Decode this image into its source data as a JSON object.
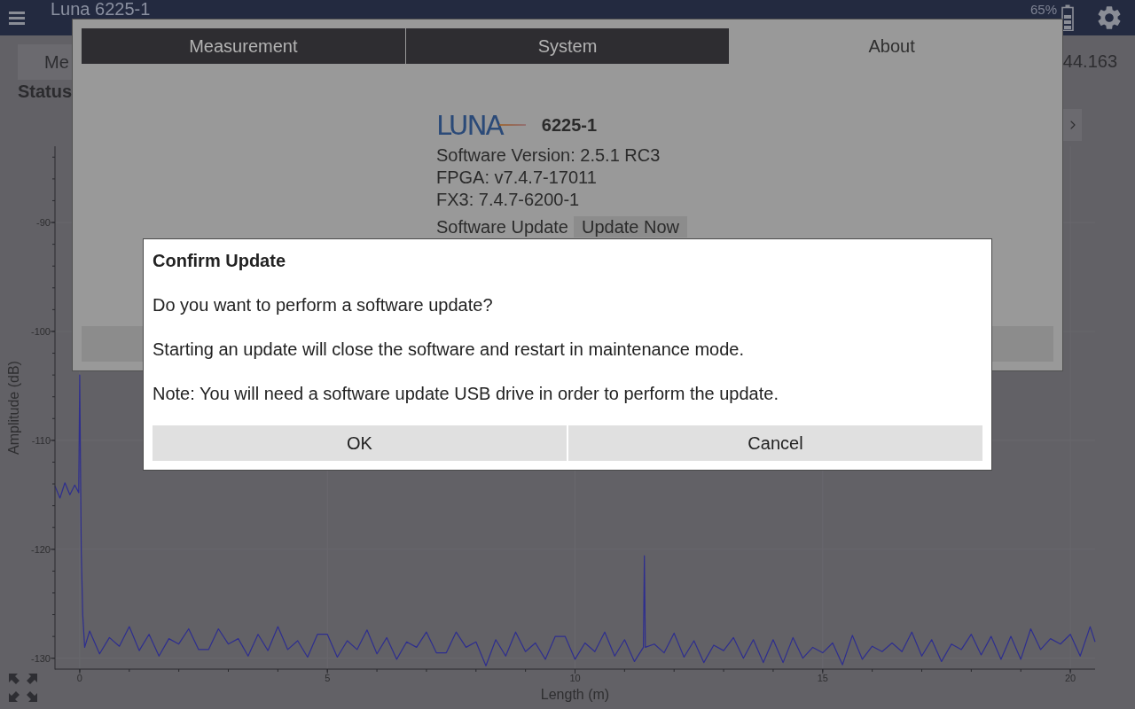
{
  "top_bar": {
    "title": "Luna 6225-1",
    "battery": "65%"
  },
  "main": {
    "mode_button": "Me",
    "status_label": "Status",
    "reading": "44.163"
  },
  "chart": {
    "chart_data": {
      "type": "line",
      "xlabel": "Length (m)",
      "ylabel": "Amplitude (dB)",
      "xlim": [
        -0.5,
        20.5
      ],
      "ylim": [
        -131,
        -83
      ],
      "xticks": [
        0,
        5,
        10,
        15,
        20
      ],
      "yticks": [
        -130,
        -120,
        -110,
        -100,
        -90
      ],
      "x": [
        -0.5,
        -0.4,
        -0.3,
        -0.2,
        -0.1,
        -0.02,
        0,
        0.03,
        0.06,
        0.1,
        0.2,
        0.4,
        0.6,
        0.8,
        1,
        1.2,
        1.4,
        1.6,
        1.8,
        2,
        2.2,
        2.4,
        2.6,
        2.8,
        3,
        3.2,
        3.4,
        3.6,
        3.8,
        4,
        4.2,
        4.4,
        4.6,
        4.8,
        5,
        5.2,
        5.4,
        5.6,
        5.8,
        6,
        6.2,
        6.4,
        6.6,
        6.8,
        7,
        7.2,
        7.4,
        7.6,
        7.8,
        8,
        8.2,
        8.4,
        8.6,
        8.8,
        9,
        9.2,
        9.4,
        9.6,
        9.8,
        10,
        10.2,
        10.4,
        10.6,
        10.8,
        11,
        11.2,
        11.38,
        11.4,
        11.42,
        11.6,
        11.8,
        12,
        12.2,
        12.4,
        12.6,
        12.8,
        13,
        13.2,
        13.4,
        13.6,
        13.8,
        14,
        14.2,
        14.4,
        14.6,
        14.8,
        15,
        15.2,
        15.4,
        15.6,
        15.8,
        16,
        16.2,
        16.4,
        16.6,
        16.8,
        17,
        17.2,
        17.4,
        17.6,
        17.8,
        18,
        18.2,
        18.4,
        18.6,
        18.8,
        19,
        19.2,
        19.4,
        19.6,
        19.8,
        20,
        20.2,
        20.4,
        20.5
      ],
      "series": [
        {
          "color": "#2e2e8f",
          "values": [
            -114.2,
            -115.3,
            -113.9,
            -115.0,
            -114.1,
            -114.8,
            -104,
            -120,
            -126,
            -129,
            -127.5,
            -129.6,
            -128.1,
            -128.9,
            -127.1,
            -129.3,
            -127.8,
            -129.8,
            -128.2,
            -128.7,
            -127.3,
            -129.2,
            -129.2,
            -127.3,
            -128.7,
            -128.2,
            -129.8,
            -127.8,
            -129.3,
            -127.1,
            -129.2,
            -128.4,
            -129.9,
            -127.8,
            -127.8,
            -129.9,
            -128.4,
            -129.2,
            -127.4,
            -129.6,
            -128.1,
            -130.1,
            -128.5,
            -129.0,
            -127.6,
            -129.5,
            -129.5,
            -127.6,
            -129.0,
            -128.5,
            -130.7,
            -128.3,
            -129.8,
            -127.6,
            -129.4,
            -128.6,
            -130.1,
            -128.0,
            -128.0,
            -130.1,
            -128.6,
            -129.4,
            -127.6,
            -129.8,
            -128.3,
            -130.3,
            -129.0,
            -120.6,
            -129.0,
            -128.7,
            -129.5,
            -127.7,
            -129.9,
            -128.4,
            -130.4,
            -128.8,
            -129.3,
            -128.1,
            -130.0,
            -128.3,
            -130.4,
            -128.3,
            -130.4,
            -128.1,
            -130.0,
            -129.0,
            -129.5,
            -128.6,
            -130.6,
            -127.9,
            -130.1,
            -128.9,
            -129.4,
            -128.6,
            -129.4,
            -127.6,
            -129.8,
            -128.3,
            -130.3,
            -128.7,
            -129.2,
            -127.8,
            -129.7,
            -128.0,
            -130.1,
            -128.0,
            -130.1,
            -127.3,
            -129.2,
            -128.2,
            -128.7,
            -127.8,
            -129.8,
            -127.1,
            -128.5
          ]
        }
      ]
    }
  },
  "settings_dialog": {
    "tabs": [
      {
        "label": "Measurement",
        "selected": false
      },
      {
        "label": "System",
        "selected": false
      },
      {
        "label": "About",
        "selected": true
      }
    ],
    "about": {
      "logo": "LUNA",
      "model": "6225-1",
      "lines": [
        "Software Version: 2.5.1 RC3",
        "FPGA: v7.4.7-17011",
        "FX3: 7.4.7-6200-1"
      ],
      "update_label": "Software Update",
      "update_button": "Update Now"
    }
  },
  "confirm_dialog": {
    "title": "Confirm Update",
    "messages": [
      "Do you want to perform a software update?",
      "Starting an update will close the software and restart in maintenance mode.",
      "Note: You will need a software update USB drive in order to perform the update."
    ],
    "buttons": [
      "OK",
      "Cancel"
    ]
  }
}
